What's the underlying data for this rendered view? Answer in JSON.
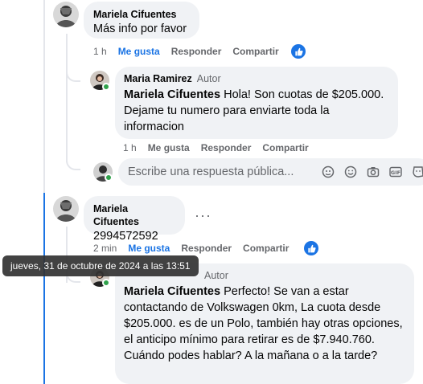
{
  "comment1": {
    "author": "Mariela Cifuentes",
    "text": "Más info por favor",
    "time": "1 h",
    "like_label": "Me gusta",
    "reply_label": "Responder",
    "share_label": "Compartir"
  },
  "reply1": {
    "author": "Maria Ramirez",
    "author_tag": "Autor",
    "mention": "Mariela Cifuentes",
    "text": " Hola! Son cuotas de $205.000. Dejame tu numero para enviarte toda la informacion",
    "time": "1 h",
    "like_label": "Me gusta",
    "reply_label": "Responder",
    "share_label": "Compartir"
  },
  "reply_box": {
    "placeholder": "Escribe una respuesta pública..."
  },
  "comment2": {
    "author": "Mariela Cifuentes",
    "text": "2994572592",
    "time": "2 min",
    "like_label": "Me gusta",
    "reply_label": "Responder",
    "share_label": "Compartir",
    "more": "···"
  },
  "tooltip": {
    "text": "jueves, 31 de octubre de 2024 a las 13:51"
  },
  "reply2": {
    "author_tag": "Autor",
    "mention": "Mariela Cifuentes",
    "text": " Perfecto! Se van a estar contactando de Volkswagen 0km, La cuota desde $205.000. es de un Polo, también hay otras opciones, el anticipo mínimo para retirar es de $7.940.760. Cuándo podes hablar? A la mañana o a la tarde?"
  },
  "colors": {
    "accent": "#1b74e4",
    "bubble": "#f0f2f5",
    "secondary_text": "#65676b",
    "online": "#31a24c"
  }
}
